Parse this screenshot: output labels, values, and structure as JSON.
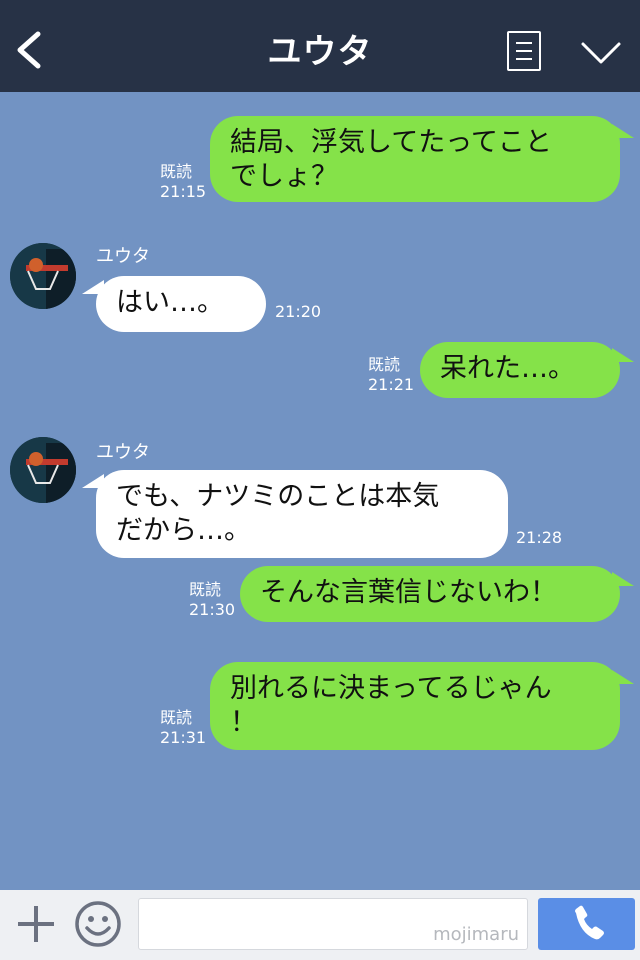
{
  "header": {
    "title": "ユウタ",
    "back_icon": "chevron-left-icon",
    "menu_icon": "menu-icon",
    "collapse_icon": "chevron-down-icon",
    "background": "#273246"
  },
  "chat": {
    "background": "#7293c3",
    "messages": [
      {
        "direction": "out",
        "text_line1": "結局、浮気してたってこと",
        "text_line2": "でしょ？",
        "read": "既読",
        "time": "21:15"
      },
      {
        "direction": "in",
        "sender": "ユウタ",
        "text": "はい…。",
        "time": "21:20"
      },
      {
        "direction": "out",
        "text": "呆れた…。",
        "read": "既読",
        "time": "21:21"
      },
      {
        "direction": "in",
        "sender": "ユウタ",
        "text_line1": "でも、ナツミのことは本気",
        "text_line2": "だから…。",
        "time": "21:28"
      },
      {
        "direction": "out",
        "text": "そんな言葉信じないわ！",
        "read": "既読",
        "time": "21:30"
      },
      {
        "direction": "out",
        "text_line1": "別れるに決まってるじゃん",
        "text_line2": "！",
        "read": "既読",
        "time": "21:31"
      }
    ]
  },
  "composer": {
    "plus_icon": "plus-icon",
    "emoji_icon": "smiley-icon",
    "watermark": "mojimaru",
    "call_icon": "phone-icon"
  },
  "colors": {
    "outgoing_bubble": "#85e249",
    "incoming_bubble": "#ffffff",
    "call_button": "#5a8ee6"
  }
}
